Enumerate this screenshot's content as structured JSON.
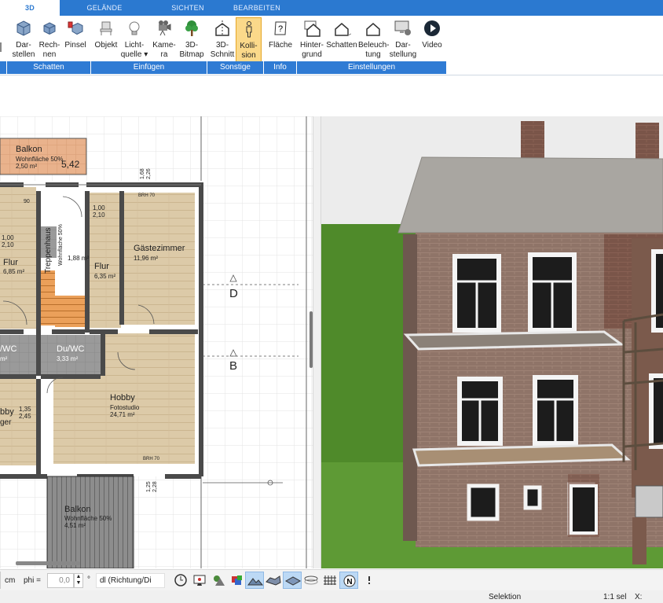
{
  "tabs": [
    {
      "label": "3D",
      "active": true
    },
    {
      "label": "GELÄNDE"
    },
    {
      "label": "SICHTEN"
    },
    {
      "label": "BEARBEITEN"
    }
  ],
  "ribbon": {
    "buttons": [
      {
        "label": "Dar-\nstellen",
        "icon": "cube-icon"
      },
      {
        "label": "Rech-\nnen",
        "icon": "cube-icon"
      },
      {
        "label": "Pinsel",
        "icon": "paint-brush-icon"
      },
      {
        "label": "Objekt",
        "icon": "chair-icon"
      },
      {
        "label": "Licht-\nquelle ▾",
        "icon": "lightbulb-icon"
      },
      {
        "label": "Kame-\nra",
        "icon": "camera-icon"
      },
      {
        "label": "3D-\nBitmap",
        "icon": "tree-icon"
      },
      {
        "label": "3D-\nSchnitt",
        "icon": "section-icon"
      },
      {
        "label": "Kolli-\nsion",
        "icon": "person-icon",
        "active": true
      },
      {
        "label": "Fläche",
        "icon": "area-info-icon"
      },
      {
        "label": "Hinter-\ngrund",
        "icon": "house-icon"
      },
      {
        "label": "Schatten",
        "icon": "house-shadow-icon"
      },
      {
        "label": "Beleuch-\ntung",
        "icon": "house-light-icon"
      },
      {
        "label": "Dar-\nstellung",
        "icon": "monitor-gear-icon"
      },
      {
        "label": "Video",
        "icon": "play-icon"
      }
    ],
    "groups": [
      "Schatten",
      "Einfügen",
      "Sonstige",
      "Info",
      "Einstellungen"
    ]
  },
  "plan": {
    "rooms": {
      "balkon_top": {
        "name": "Balkon",
        "sub": "Wohnfläche 50%",
        "area": "2,50 m²",
        "dim": "5,42"
      },
      "flur_left": {
        "name": "Flur",
        "area": "6,85 m²"
      },
      "treppenhaus": {
        "name": "Treppenhaus",
        "sub": "Wohnfläche 50%",
        "area": "1,88 m²"
      },
      "flur_mid": {
        "name": "Flur",
        "area": "6,35 m²"
      },
      "gaestezimmer": {
        "name": "Gästezimmer",
        "area": "11,96 m²"
      },
      "wc_left": {
        "name": "/WC",
        "area": "m²"
      },
      "duwc": {
        "name": "Du/WC",
        "area": "3,33 m²"
      },
      "hobby_left": {
        "name": "bby",
        "area": "ger"
      },
      "hobby": {
        "name": "Hobby",
        "sub": "Fotostudio",
        "area": "24,71 m²"
      },
      "balkon_bottom": {
        "name": "Balkon",
        "sub": "Wohnfläche 50%",
        "area": "4,51 m²"
      }
    },
    "labels": {
      "brh1": "BRH 70",
      "brh2": "BRH 70",
      "d": "D",
      "b": "B",
      "dim_100": "1,00",
      "dim_210": "2,10",
      "dim_100b": "1,00",
      "dim_210b": "2,10",
      "dim_90": "90",
      "dim_135": "1,35",
      "dim_245": "2,45",
      "dim_168": "1,68",
      "dim_226": "2,26",
      "dim_125": "1,25",
      "dim_228": "2,28"
    }
  },
  "toolbar": {
    "unit": "cm",
    "phi_label": "phi =",
    "phi_value": "0,0",
    "deg": "°",
    "dl_value": "dl (Richtung/Di"
  },
  "status": {
    "mode": "Selektion",
    "scale": "1:1 sel",
    "x_label": "X:"
  },
  "colors": {
    "accent": "#2b79d0",
    "active_button": "#fbd98a",
    "floor_wood": "#d9c7a6"
  }
}
